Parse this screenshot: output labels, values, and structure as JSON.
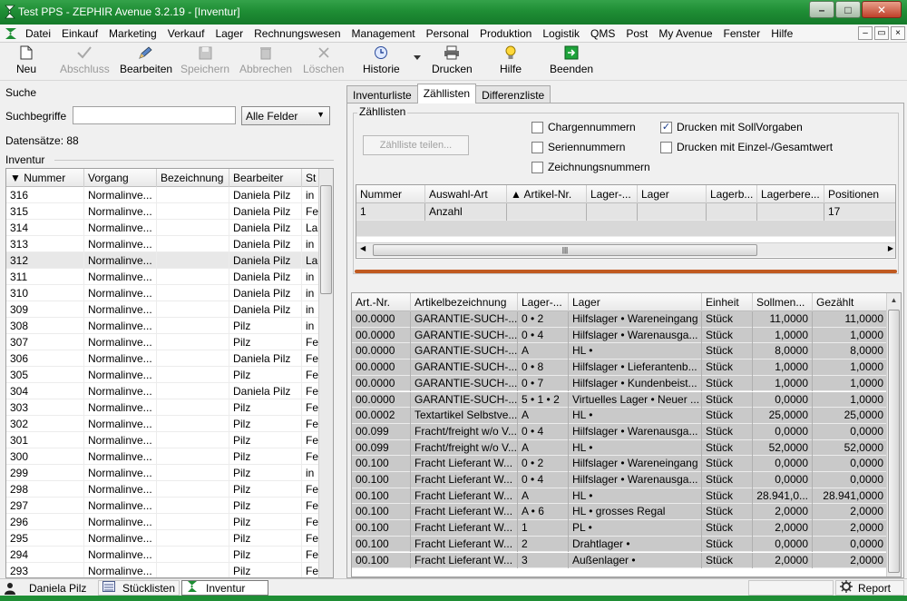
{
  "window": {
    "title": "Test PPS - ZEPHIR Avenue 3.2.19 - [Inventur]",
    "buttons": {
      "minimize": "–",
      "maximize": "□",
      "close": "✕"
    },
    "mdi_buttons": [
      "–",
      "▭",
      "×"
    ]
  },
  "menu": [
    "Datei",
    "Einkauf",
    "Marketing",
    "Verkauf",
    "Lager",
    "Rechnungswesen",
    "Management",
    "Personal",
    "Produktion",
    "Logistik",
    "QMS",
    "Post",
    "My Avenue",
    "Fenster",
    "Hilfe"
  ],
  "toolbar": {
    "new": "Neu",
    "finish": "Abschluss",
    "edit": "Bearbeiten",
    "save": "Speichern",
    "cancel": "Abbrechen",
    "delete": "Löschen",
    "history": "Historie",
    "print": "Drucken",
    "help": "Hilfe",
    "exit": "Beenden"
  },
  "search": {
    "section": "Suche",
    "label": "Suchbegriffe",
    "value": "",
    "field_select": "Alle Felder",
    "count": "Datensätze: 88"
  },
  "inventur": {
    "section": "Inventur",
    "columns": [
      "▼ Nummer",
      "Vorgang",
      "Bezeichnung",
      "Bearbeiter",
      "St"
    ],
    "rows": [
      [
        "316",
        "Normalinve...",
        "",
        "Daniela Pilz",
        "in"
      ],
      [
        "315",
        "Normalinve...",
        "",
        "Daniela Pilz",
        "Fe"
      ],
      [
        "314",
        "Normalinve...",
        "",
        "Daniela Pilz",
        "La"
      ],
      [
        "313",
        "Normalinve...",
        "",
        "Daniela Pilz",
        "in"
      ],
      [
        "312",
        "Normalinve...",
        "",
        "Daniela Pilz",
        "La"
      ],
      [
        "311",
        "Normalinve...",
        "",
        "Daniela Pilz",
        "in"
      ],
      [
        "310",
        "Normalinve...",
        "",
        "Daniela Pilz",
        "in"
      ],
      [
        "309",
        "Normalinve...",
        "",
        "Daniela Pilz",
        "in"
      ],
      [
        "308",
        "Normalinve...",
        "",
        "Pilz",
        "in"
      ],
      [
        "307",
        "Normalinve...",
        "",
        "Pilz",
        "Fe"
      ],
      [
        "306",
        "Normalinve...",
        "",
        "Daniela Pilz",
        "Fe"
      ],
      [
        "305",
        "Normalinve...",
        "",
        "Pilz",
        "Fe"
      ],
      [
        "304",
        "Normalinve...",
        "",
        "Daniela Pilz",
        "Fe"
      ],
      [
        "303",
        "Normalinve...",
        "",
        "Pilz",
        "Fe"
      ],
      [
        "302",
        "Normalinve...",
        "",
        "Pilz",
        "Fe"
      ],
      [
        "301",
        "Normalinve...",
        "",
        "Pilz",
        "Fe"
      ],
      [
        "300",
        "Normalinve...",
        "",
        "Pilz",
        "Fe"
      ],
      [
        "299",
        "Normalinve...",
        "",
        "Pilz",
        "in"
      ],
      [
        "298",
        "Normalinve...",
        "",
        "Pilz",
        "Fe"
      ],
      [
        "297",
        "Normalinve...",
        "",
        "Pilz",
        "Fe"
      ],
      [
        "296",
        "Normalinve...",
        "",
        "Pilz",
        "Fe"
      ],
      [
        "295",
        "Normalinve...",
        "",
        "Pilz",
        "Fe"
      ],
      [
        "294",
        "Normalinve...",
        "",
        "Pilz",
        "Fe"
      ],
      [
        "293",
        "Normalinve...",
        "",
        "Pilz",
        "Fe"
      ]
    ]
  },
  "tabs": [
    "Inventurliste",
    "Zähllisten",
    "Differenzliste"
  ],
  "zaehllisten": {
    "group_title": "Zähllisten",
    "split_button": "Zählliste teilen...",
    "checks": {
      "batch": {
        "label": "Chargennummern",
        "checked": ""
      },
      "serial": {
        "label": "Seriennummern",
        "checked": ""
      },
      "drawing": {
        "label": "Zeichnungsnummern",
        "checked": ""
      },
      "print_target": {
        "label": "Drucken mit SollVorgaben",
        "checked": "✓"
      },
      "print_single": {
        "label": "Drucken mit Einzel-/Gesamtwert",
        "checked": ""
      }
    },
    "list_columns": [
      "Nummer",
      "Auswahl-Art",
      "▲ Artikel-Nr.",
      "Lager-...",
      "Lager",
      "Lagerb...",
      "Lagerbere...",
      "Positionen"
    ],
    "list_rows": [
      [
        "1",
        "Anzahl",
        "",
        "",
        "",
        "",
        "",
        "17"
      ]
    ],
    "hscroll_grip": "|||"
  },
  "positions": {
    "columns": [
      "Art.-Nr.",
      "Artikelbezeichnung",
      "Lager-...",
      "Lager",
      "Einheit",
      "Sollmen...",
      "Gezählt"
    ],
    "rows": [
      [
        "00.0000",
        "GARANTIE-SUCH-...",
        "0 • 2",
        "Hilfslager • Wareneingang",
        "Stück",
        "11,0000",
        "11,0000"
      ],
      [
        "00.0000",
        "GARANTIE-SUCH-...",
        "0 • 4",
        "Hilfslager • Warenausga...",
        "Stück",
        "1,0000",
        "1,0000"
      ],
      [
        "00.0000",
        "GARANTIE-SUCH-...",
        "A",
        "HL •",
        "Stück",
        "8,0000",
        "8,0000"
      ],
      [
        "00.0000",
        "GARANTIE-SUCH-...",
        "0 • 8",
        "Hilfslager • Lieferantenb...",
        "Stück",
        "1,0000",
        "1,0000"
      ],
      [
        "00.0000",
        "GARANTIE-SUCH-...",
        "0 • 7",
        "Hilfslager • Kundenbeist...",
        "Stück",
        "1,0000",
        "1,0000"
      ],
      [
        "00.0000",
        "GARANTIE-SUCH-...",
        "5 • 1 • 2",
        "Virtuelles Lager • Neuer ...",
        "Stück",
        "0,0000",
        "1,0000"
      ],
      [
        "00.0002",
        "Textartikel Selbstve...",
        "A",
        "HL •",
        "Stück",
        "25,0000",
        "25,0000"
      ],
      [
        "00.099",
        "Fracht/freight w/o V...",
        "0 • 4",
        "Hilfslager • Warenausga...",
        "Stück",
        "0,0000",
        "0,0000"
      ],
      [
        "00.099",
        "Fracht/freight w/o V...",
        "A",
        "HL •",
        "Stück",
        "52,0000",
        "52,0000"
      ],
      [
        "00.100",
        "Fracht Lieferant  W...",
        "0 • 2",
        "Hilfslager • Wareneingang",
        "Stück",
        "0,0000",
        "0,0000"
      ],
      [
        "00.100",
        "Fracht Lieferant  W...",
        "0 • 4",
        "Hilfslager • Warenausga...",
        "Stück",
        "0,0000",
        "0,0000"
      ],
      [
        "00.100",
        "Fracht Lieferant  W...",
        "A",
        "HL •",
        "Stück",
        "28.941,0...",
        "28.941,0000"
      ],
      [
        "00.100",
        "Fracht Lieferant  W...",
        "A • 6",
        "HL • grosses Regal",
        "Stück",
        "2,0000",
        "2,0000"
      ],
      [
        "00.100",
        "Fracht Lieferant  W...",
        "1",
        "PL •",
        "Stück",
        "2,0000",
        "2,0000"
      ],
      [
        "00.100",
        "Fracht Lieferant  W...",
        "2",
        "Drahtlager •",
        "Stück",
        "0,0000",
        "0,0000"
      ],
      [
        "00.100",
        "Fracht Lieferant  W...",
        "3",
        "Außenlager •",
        "Stück",
        "2,0000",
        "2,0000"
      ]
    ]
  },
  "statusbar": {
    "user": "Daniela Pilz",
    "window1": "Stücklisten",
    "window2": "Inventur",
    "report": "Report"
  },
  "colors": {
    "title_green": "#1f8e35",
    "row_gray": "#c9c9c9",
    "splitter": "#c05a20"
  }
}
